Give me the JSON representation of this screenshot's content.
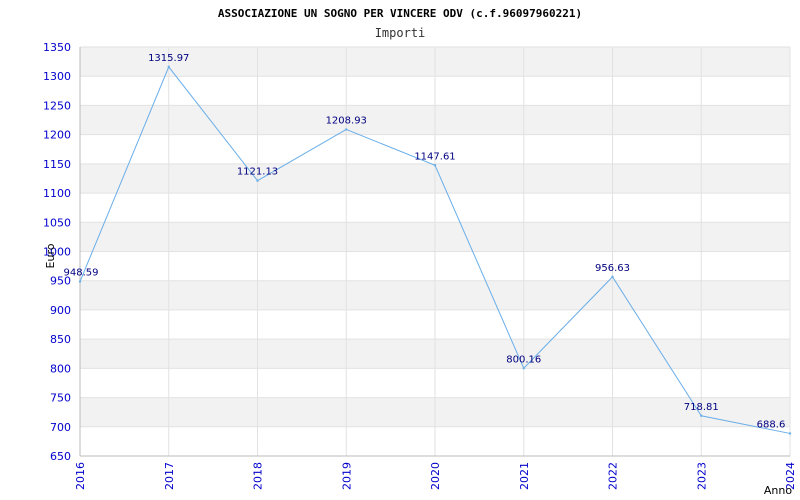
{
  "title": "ASSOCIAZIONE UN SOGNO PER VINCERE ODV (c.f.96097960221)",
  "subtitle": "Importi",
  "chart_data": {
    "type": "line",
    "title": "ASSOCIAZIONE UN SOGNO PER VINCERE ODV (c.f.96097960221)",
    "subtitle": "Importi",
    "xlabel": "Anno",
    "ylabel": "Euro",
    "categories": [
      "2016",
      "2017",
      "2018",
      "2019",
      "2020",
      "2021",
      "2022",
      "2023",
      "2024"
    ],
    "series": [
      {
        "values": [
          948.59,
          1315.97,
          1121.13,
          1208.93,
          1147.61,
          800.16,
          956.63,
          718.81,
          688.6
        ],
        "labels": [
          "948.59",
          "1315.97",
          "1121.13",
          "1208.93",
          "1147.61",
          "800.16",
          "956.63",
          "718.81",
          "688.6"
        ]
      }
    ],
    "ylim": [
      650,
      1350
    ],
    "yticks": [
      650,
      700,
      750,
      800,
      850,
      900,
      950,
      1000,
      1050,
      1100,
      1150,
      1200,
      1250,
      1300,
      1350
    ],
    "grid": true,
    "line_color": "#6aaee8",
    "band_color": "#f2f2f2",
    "axis_text_color": "#0000cc",
    "label_color": "#000080"
  }
}
